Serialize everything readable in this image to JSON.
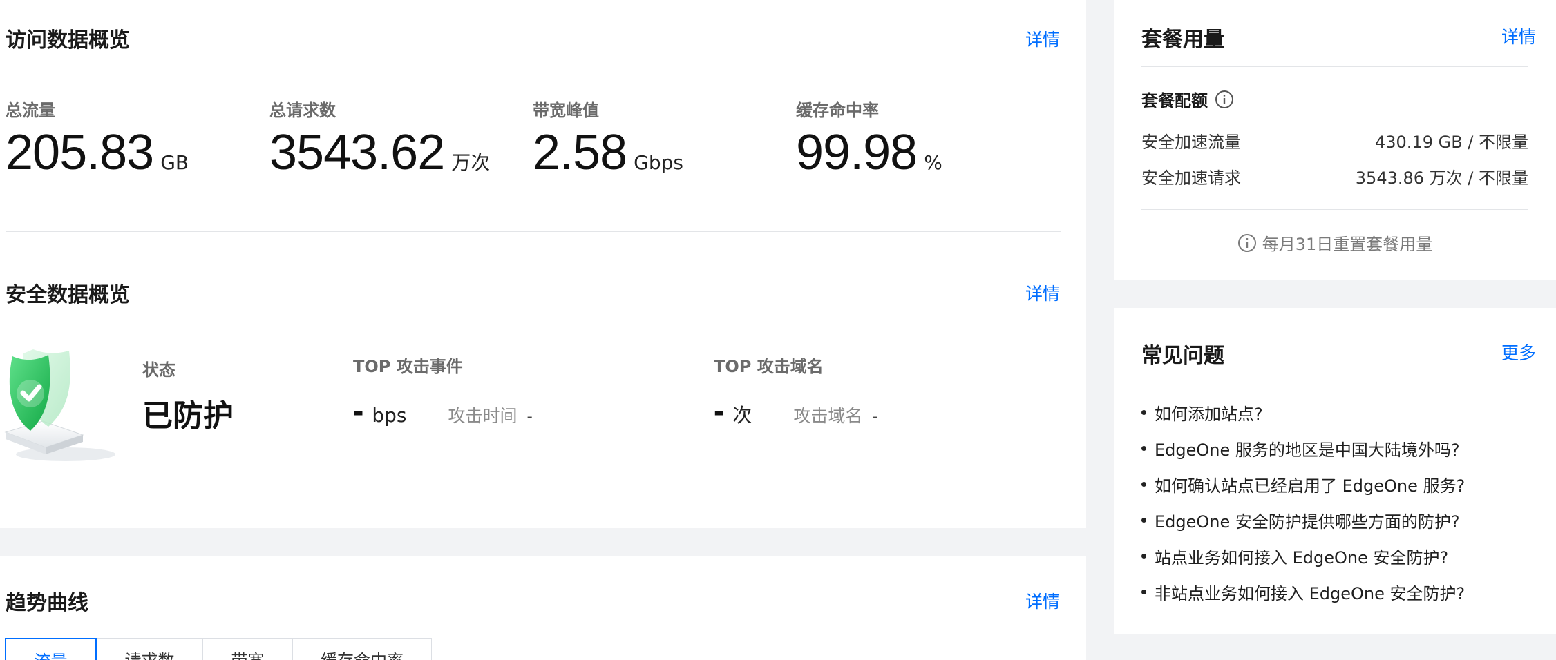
{
  "overview": {
    "title": "访问数据概览",
    "detail_link": "详情",
    "metrics": [
      {
        "label": "总流量",
        "value": "205.83",
        "unit": "GB"
      },
      {
        "label": "总请求数",
        "value": "3543.62",
        "unit": "万次"
      },
      {
        "label": "带宽峰值",
        "value": "2.58",
        "unit": "Gbps"
      },
      {
        "label": "缓存命中率",
        "value": "99.98",
        "unit": "%"
      }
    ]
  },
  "security": {
    "title": "安全数据概览",
    "detail_link": "详情",
    "status_label": "状态",
    "status_value": "已防护",
    "top_event": {
      "label": "TOP 攻击事件",
      "value": "-",
      "unit": "bps",
      "key": "攻击时间",
      "key_value": "-"
    },
    "top_domain": {
      "label": "TOP 攻击域名",
      "value": "-",
      "unit": "次",
      "key": "攻击域名",
      "key_value": "-"
    },
    "shield_icon": "shield-check-icon"
  },
  "trend": {
    "title": "趋势曲线",
    "detail_link": "详情",
    "tabs": [
      "流量",
      "请求数",
      "带宽",
      "缓存命中率"
    ],
    "active_tab": "流量"
  },
  "plan": {
    "title": "套餐用量",
    "detail_link": "详情",
    "quota_label": "套餐配额",
    "rows": [
      {
        "label": "安全加速流量",
        "value": "430.19 GB / 不限量"
      },
      {
        "label": "安全加速请求",
        "value": "3543.86 万次 / 不限量"
      }
    ],
    "note": "每月31日重置套餐用量"
  },
  "faq": {
    "title": "常见问题",
    "more_link": "更多",
    "items": [
      "如何添加站点?",
      "EdgeOne 服务的地区是中国大陆境外吗?",
      "如何确认站点已经启用了 EdgeOne 服务?",
      "EdgeOne 安全防护提供哪些方面的防护?",
      "站点业务如何接入 EdgeOne 安全防护?",
      "非站点业务如何接入 EdgeOne 安全防护?"
    ]
  },
  "colors": {
    "accent": "#006eff",
    "background": "#f2f3f5",
    "shield_green": "#27c45a"
  }
}
